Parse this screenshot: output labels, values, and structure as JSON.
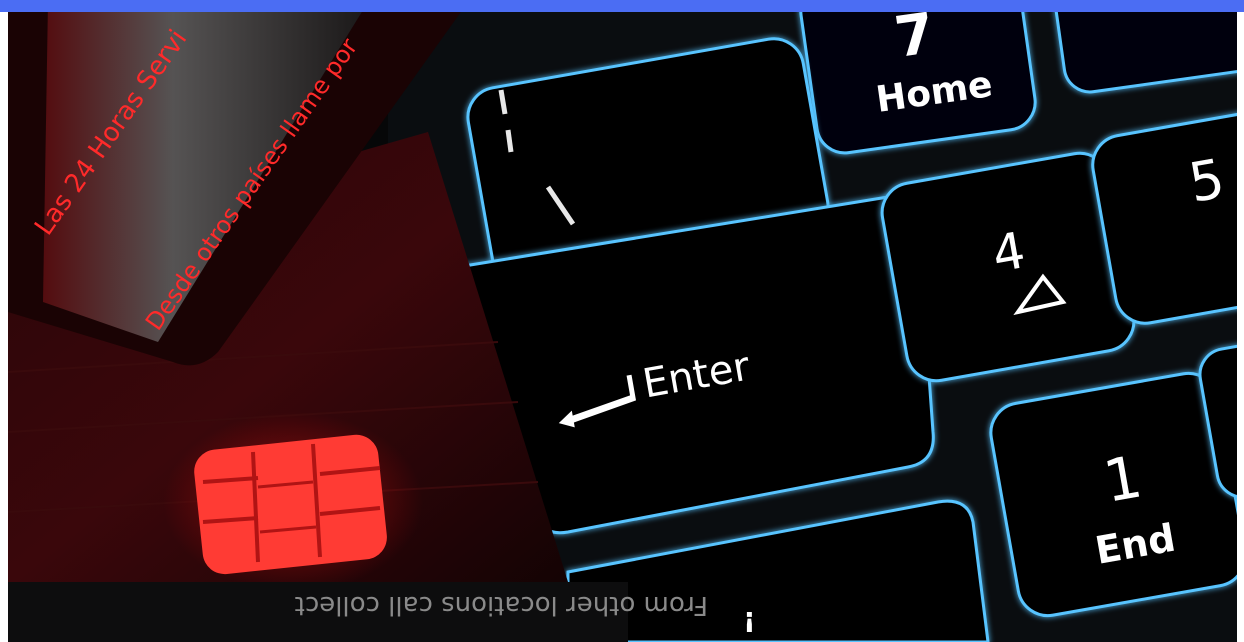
{
  "image": {
    "top_bar_color": "#4b6df3",
    "keyboard_glow_color": "#58c4ff",
    "card_glow_color": "#ff2a2a",
    "card": {
      "line_1": "Las 24 Horas Servi",
      "line_2": "Desde otros países llame por",
      "mirrored_line": "From other locations call collect"
    },
    "keys": {
      "enter": "Enter",
      "home_num": "7",
      "home_label": "Home",
      "four_num": "4",
      "five_num": "5",
      "one_num": "1",
      "end_label": "End",
      "small_bottom": "¡"
    }
  }
}
